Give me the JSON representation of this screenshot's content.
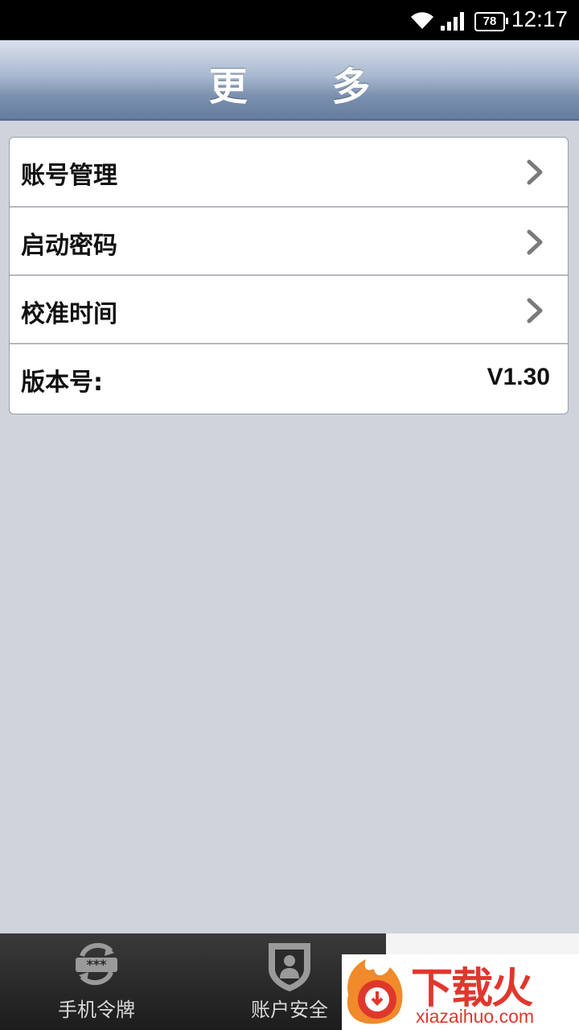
{
  "status_bar": {
    "time": "12:17",
    "battery": "78",
    "icons": [
      "wifi-icon",
      "signal-icon",
      "battery-icon"
    ]
  },
  "header": {
    "title": "更 多"
  },
  "settings": {
    "items": [
      {
        "label": "账号管理",
        "icon": "chevron-right-icon"
      },
      {
        "label": "启动密码",
        "icon": "chevron-right-icon"
      },
      {
        "label": "校准时间",
        "icon": "chevron-right-icon"
      },
      {
        "label": "版本号:",
        "value": "V1.30"
      }
    ]
  },
  "tabbar": {
    "tabs": [
      {
        "label": "手机令牌",
        "icon": "token-icon"
      },
      {
        "label": "账户安全",
        "icon": "account-shield-icon"
      },
      {
        "label": "",
        "icon": "",
        "active": true
      }
    ]
  },
  "watermark": {
    "brand": "下载火",
    "domain": "xiazaihuo.com",
    "accent": "#e0372d"
  }
}
